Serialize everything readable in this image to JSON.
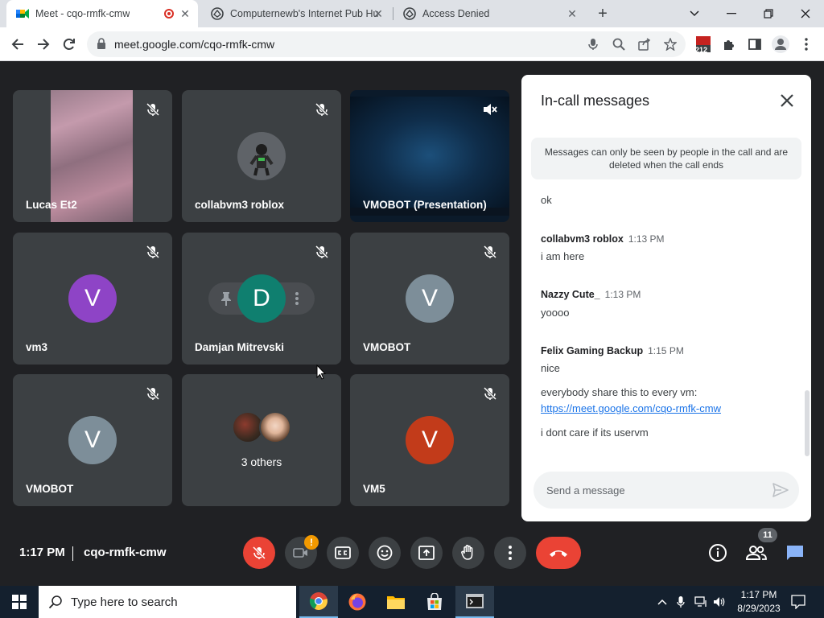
{
  "tabs": [
    {
      "title": "Meet - cqo-rmfk-cmw",
      "active": true,
      "recording": true
    },
    {
      "title": "Computernewb's Internet Pub Hu",
      "active": false
    },
    {
      "title": "Access Denied",
      "active": false
    }
  ],
  "address_bar": {
    "url": "meet.google.com/cqo-rmfk-cmw"
  },
  "extension_badge": "212",
  "participants": [
    {
      "name": "Lucas Et2",
      "kind": "video",
      "muted": true
    },
    {
      "name": "collabvm3 roblox",
      "kind": "picture",
      "muted": true
    },
    {
      "name": "VMOBOT (Presentation)",
      "kind": "presentation",
      "muted": true
    },
    {
      "name": "vm3",
      "kind": "avatar",
      "initial": "V",
      "color": "#8e44c6",
      "muted": true
    },
    {
      "name": "Damjan Mitrevski",
      "kind": "avatar",
      "initial": "D",
      "color": "#0f7f6f",
      "muted": true
    },
    {
      "name": "VMOBOT",
      "kind": "avatar",
      "initial": "V",
      "color": "#7d8e99",
      "muted": true
    },
    {
      "name": "VMOBOT",
      "kind": "avatar",
      "initial": "V",
      "color": "#7d8e99",
      "muted": true
    },
    {
      "name": "3 others",
      "kind": "others"
    },
    {
      "name": "VM5",
      "kind": "avatar",
      "initial": "V",
      "color": "#c23b1a",
      "muted": true
    }
  ],
  "chat": {
    "title": "In-call messages",
    "notice": "Messages can only be seen by people in the call and are deleted when the call ends",
    "messages": [
      {
        "text": "ok"
      },
      {
        "sender": "collabvm3 roblox",
        "time": "1:13 PM",
        "text": "i am here"
      },
      {
        "sender": "Nazzy Cute_",
        "time": "1:13 PM",
        "text": "yoooo"
      },
      {
        "sender": "Felix Gaming Backup",
        "time": "1:15 PM",
        "text": "nice"
      },
      {
        "text": "everybody share this to every vm:"
      },
      {
        "link": "https://meet.google.com/cqo-rmfk-cmw"
      },
      {
        "text": "i dont care if its uservm"
      }
    ],
    "input_placeholder": "Send a message"
  },
  "bottom_bar": {
    "time": "1:17 PM",
    "meeting_code": "cqo-rmfk-cmw",
    "people_count": "11"
  },
  "taskbar": {
    "search_placeholder": "Type here to search",
    "time": "1:17 PM",
    "date": "8/29/2023"
  },
  "colors": {
    "meet_bg": "#202124",
    "tile_bg": "#3c4043",
    "end_call_red": "#ea4335",
    "link_blue": "#1a73e8",
    "chat_active_blue": "#8ab4f8"
  }
}
